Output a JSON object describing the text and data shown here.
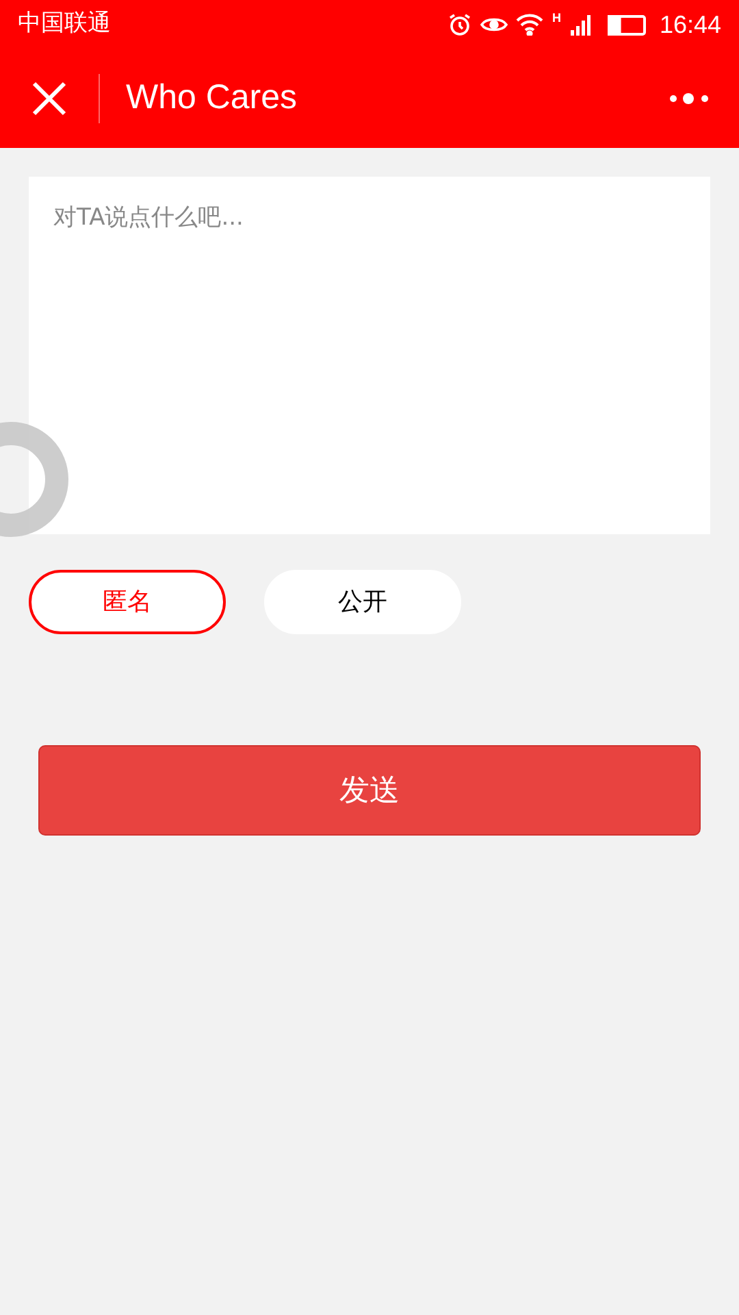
{
  "status_bar": {
    "carrier": "中国联通",
    "network": "H",
    "time": "16:44",
    "battery": {
      "level": 0.35
    }
  },
  "nav_bar": {
    "title": "Who Cares"
  },
  "message": {
    "placeholder": "对TA说点什么吧..."
  },
  "visibility_options": [
    {
      "label": "匿名",
      "selected": true
    },
    {
      "label": "公开",
      "selected": false
    }
  ],
  "send_button": {
    "label": "发送"
  }
}
